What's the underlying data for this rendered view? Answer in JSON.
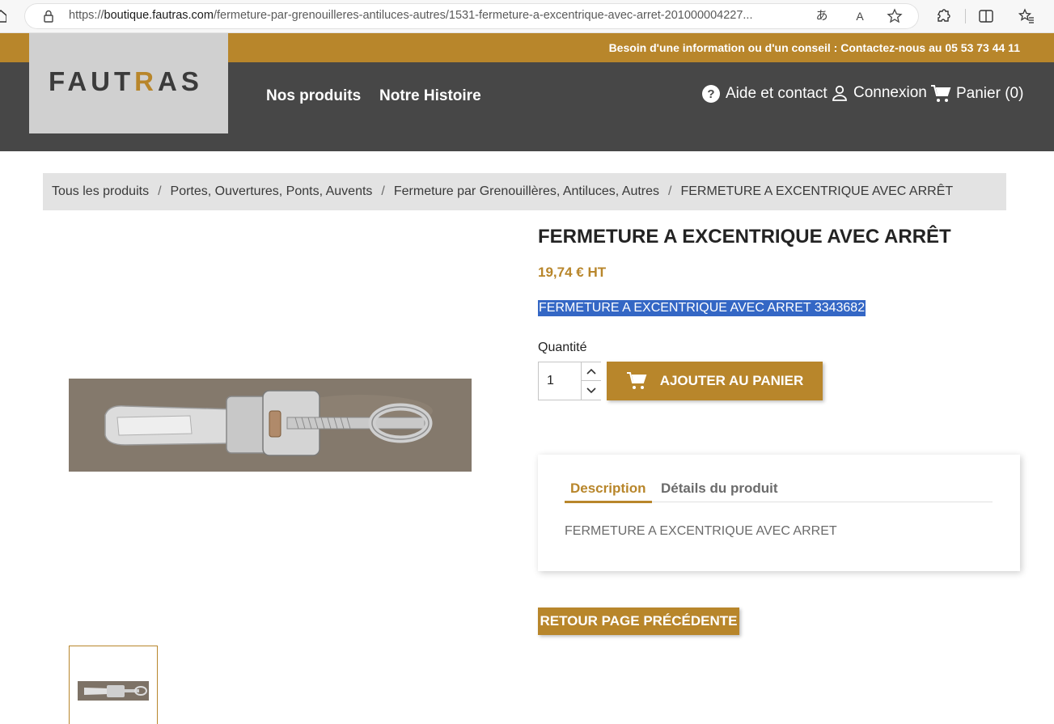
{
  "browser": {
    "url_prefix": "https://",
    "url_host": "boutique.fautras.com",
    "url_path": "/fermeture-par-grenouilleres-antiluces-autres/1531-fermeture-a-excentrique-avec-arret-201000004227..."
  },
  "info_bar": {
    "text": "Besoin d'une information ou d'un conseil : Contactez-nous au 05 53 73 44 11"
  },
  "header": {
    "logo_part1": "FAUT",
    "logo_accent": "R",
    "logo_part2": "AS",
    "nav": [
      "Nos produits",
      "Notre Histoire"
    ],
    "help_label": "Aide et contact",
    "login_label": "Connexion",
    "cart_label": "Panier (0)"
  },
  "breadcrumb": [
    "Tous les produits",
    "Portes, Ouvertures, Ponts, Auvents",
    "Fermeture par Grenouillères, Antiluces, Autres",
    "FERMETURE A EXCENTRIQUE AVEC ARRÊT"
  ],
  "product": {
    "title": "FERMETURE A EXCENTRIQUE AVEC ARRÊT",
    "price": "19,74 € HT",
    "short_description": "FERMETURE A EXCENTRIQUE AVEC ARRET 3343682",
    "quantity_label": "Quantité",
    "quantity_value": "1",
    "add_to_cart": "AJOUTER AU PANIER",
    "back_button": "RETOUR PAGE PRÉCÉDENTE"
  },
  "tabs": {
    "items": [
      "Description",
      "Détails du produit"
    ],
    "active": "Description",
    "content": "FERMETURE A EXCENTRIQUE AVEC ARRET"
  },
  "colors": {
    "accent": "#b8862b",
    "header": "#474747",
    "selection": "#3467c5"
  }
}
